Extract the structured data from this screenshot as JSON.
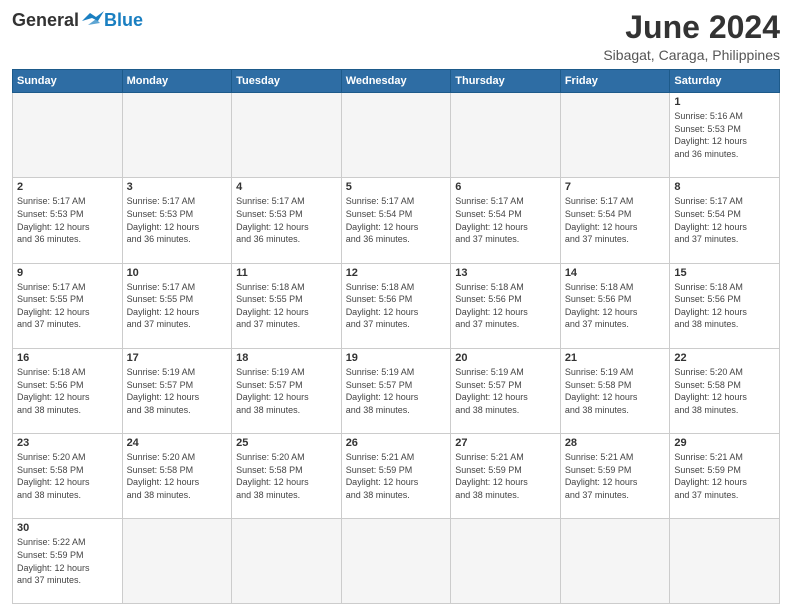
{
  "logo": {
    "general": "General",
    "blue": "Blue"
  },
  "title": "June 2024",
  "subtitle": "Sibagat, Caraga, Philippines",
  "days_of_week": [
    "Sunday",
    "Monday",
    "Tuesday",
    "Wednesday",
    "Thursday",
    "Friday",
    "Saturday"
  ],
  "weeks": [
    [
      {
        "day": "",
        "info": ""
      },
      {
        "day": "",
        "info": ""
      },
      {
        "day": "",
        "info": ""
      },
      {
        "day": "",
        "info": ""
      },
      {
        "day": "",
        "info": ""
      },
      {
        "day": "",
        "info": ""
      },
      {
        "day": "1",
        "info": "Sunrise: 5:16 AM\nSunset: 5:53 PM\nDaylight: 12 hours\nand 36 minutes."
      }
    ],
    [
      {
        "day": "2",
        "info": "Sunrise: 5:17 AM\nSunset: 5:53 PM\nDaylight: 12 hours\nand 36 minutes."
      },
      {
        "day": "3",
        "info": "Sunrise: 5:17 AM\nSunset: 5:53 PM\nDaylight: 12 hours\nand 36 minutes."
      },
      {
        "day": "4",
        "info": "Sunrise: 5:17 AM\nSunset: 5:53 PM\nDaylight: 12 hours\nand 36 minutes."
      },
      {
        "day": "5",
        "info": "Sunrise: 5:17 AM\nSunset: 5:54 PM\nDaylight: 12 hours\nand 36 minutes."
      },
      {
        "day": "6",
        "info": "Sunrise: 5:17 AM\nSunset: 5:54 PM\nDaylight: 12 hours\nand 37 minutes."
      },
      {
        "day": "7",
        "info": "Sunrise: 5:17 AM\nSunset: 5:54 PM\nDaylight: 12 hours\nand 37 minutes."
      },
      {
        "day": "8",
        "info": "Sunrise: 5:17 AM\nSunset: 5:54 PM\nDaylight: 12 hours\nand 37 minutes."
      }
    ],
    [
      {
        "day": "9",
        "info": "Sunrise: 5:17 AM\nSunset: 5:55 PM\nDaylight: 12 hours\nand 37 minutes."
      },
      {
        "day": "10",
        "info": "Sunrise: 5:17 AM\nSunset: 5:55 PM\nDaylight: 12 hours\nand 37 minutes."
      },
      {
        "day": "11",
        "info": "Sunrise: 5:18 AM\nSunset: 5:55 PM\nDaylight: 12 hours\nand 37 minutes."
      },
      {
        "day": "12",
        "info": "Sunrise: 5:18 AM\nSunset: 5:56 PM\nDaylight: 12 hours\nand 37 minutes."
      },
      {
        "day": "13",
        "info": "Sunrise: 5:18 AM\nSunset: 5:56 PM\nDaylight: 12 hours\nand 37 minutes."
      },
      {
        "day": "14",
        "info": "Sunrise: 5:18 AM\nSunset: 5:56 PM\nDaylight: 12 hours\nand 37 minutes."
      },
      {
        "day": "15",
        "info": "Sunrise: 5:18 AM\nSunset: 5:56 PM\nDaylight: 12 hours\nand 38 minutes."
      }
    ],
    [
      {
        "day": "16",
        "info": "Sunrise: 5:18 AM\nSunset: 5:56 PM\nDaylight: 12 hours\nand 38 minutes."
      },
      {
        "day": "17",
        "info": "Sunrise: 5:19 AM\nSunset: 5:57 PM\nDaylight: 12 hours\nand 38 minutes."
      },
      {
        "day": "18",
        "info": "Sunrise: 5:19 AM\nSunset: 5:57 PM\nDaylight: 12 hours\nand 38 minutes."
      },
      {
        "day": "19",
        "info": "Sunrise: 5:19 AM\nSunset: 5:57 PM\nDaylight: 12 hours\nand 38 minutes."
      },
      {
        "day": "20",
        "info": "Sunrise: 5:19 AM\nSunset: 5:57 PM\nDaylight: 12 hours\nand 38 minutes."
      },
      {
        "day": "21",
        "info": "Sunrise: 5:19 AM\nSunset: 5:58 PM\nDaylight: 12 hours\nand 38 minutes."
      },
      {
        "day": "22",
        "info": "Sunrise: 5:20 AM\nSunset: 5:58 PM\nDaylight: 12 hours\nand 38 minutes."
      }
    ],
    [
      {
        "day": "23",
        "info": "Sunrise: 5:20 AM\nSunset: 5:58 PM\nDaylight: 12 hours\nand 38 minutes."
      },
      {
        "day": "24",
        "info": "Sunrise: 5:20 AM\nSunset: 5:58 PM\nDaylight: 12 hours\nand 38 minutes."
      },
      {
        "day": "25",
        "info": "Sunrise: 5:20 AM\nSunset: 5:58 PM\nDaylight: 12 hours\nand 38 minutes."
      },
      {
        "day": "26",
        "info": "Sunrise: 5:21 AM\nSunset: 5:59 PM\nDaylight: 12 hours\nand 38 minutes."
      },
      {
        "day": "27",
        "info": "Sunrise: 5:21 AM\nSunset: 5:59 PM\nDaylight: 12 hours\nand 38 minutes."
      },
      {
        "day": "28",
        "info": "Sunrise: 5:21 AM\nSunset: 5:59 PM\nDaylight: 12 hours\nand 37 minutes."
      },
      {
        "day": "29",
        "info": "Sunrise: 5:21 AM\nSunset: 5:59 PM\nDaylight: 12 hours\nand 37 minutes."
      }
    ],
    [
      {
        "day": "30",
        "info": "Sunrise: 5:22 AM\nSunset: 5:59 PM\nDaylight: 12 hours\nand 37 minutes."
      },
      {
        "day": "",
        "info": ""
      },
      {
        "day": "",
        "info": ""
      },
      {
        "day": "",
        "info": ""
      },
      {
        "day": "",
        "info": ""
      },
      {
        "day": "",
        "info": ""
      },
      {
        "day": "",
        "info": ""
      }
    ]
  ]
}
